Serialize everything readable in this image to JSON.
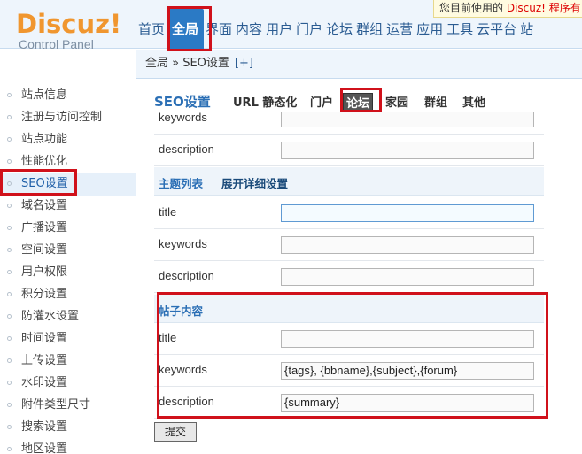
{
  "header": {
    "logo_main": "Discuz!",
    "logo_sub": "Control Panel",
    "notice_prefix": "您目前使用的 ",
    "notice_highlight": "Discuz! 程序有",
    "nav": [
      "首页",
      "全局",
      "界面",
      "内容",
      "用户",
      "门户",
      "论坛",
      "群组",
      "运营",
      "应用",
      "工具",
      "云平台",
      "站"
    ],
    "active_nav": "全局"
  },
  "breadcrumb": {
    "text": "全局 » SEO设置",
    "plus": "[+]"
  },
  "sidebar": {
    "items": [
      "站点信息",
      "注册与访问控制",
      "站点功能",
      "性能优化",
      "SEO设置",
      "域名设置",
      "广播设置",
      "空间设置",
      "用户权限",
      "积分设置",
      "防灌水设置",
      "时间设置",
      "上传设置",
      "水印设置",
      "附件类型尺寸",
      "搜索设置",
      "地区设置"
    ],
    "active": "SEO设置"
  },
  "tabs": {
    "title": "SEO设置",
    "items": [
      "URL 静态化",
      "门户",
      "论坛",
      "家园",
      "群组",
      "其他"
    ],
    "active": "论坛"
  },
  "form": {
    "row0": {
      "label": "keywords",
      "value": ""
    },
    "row1": {
      "label": "description",
      "value": ""
    },
    "section1": {
      "title": "主题列表",
      "link": "展开详细设置"
    },
    "row2": {
      "label": "title",
      "value": ""
    },
    "row3": {
      "label": "keywords",
      "value": ""
    },
    "row4": {
      "label": "description",
      "value": ""
    },
    "section2": {
      "title": "帖子内容"
    },
    "row5": {
      "label": "title",
      "value": ""
    },
    "row6": {
      "label": "keywords",
      "value": "{tags}, {bbname},{subject},{forum}"
    },
    "row7": {
      "label": "description",
      "value": "{summary}"
    }
  },
  "submit_label": "提交",
  "colors": {
    "accent": "#2b7ac5",
    "highlight_box": "#d0111b",
    "logo": "#f0962f"
  }
}
